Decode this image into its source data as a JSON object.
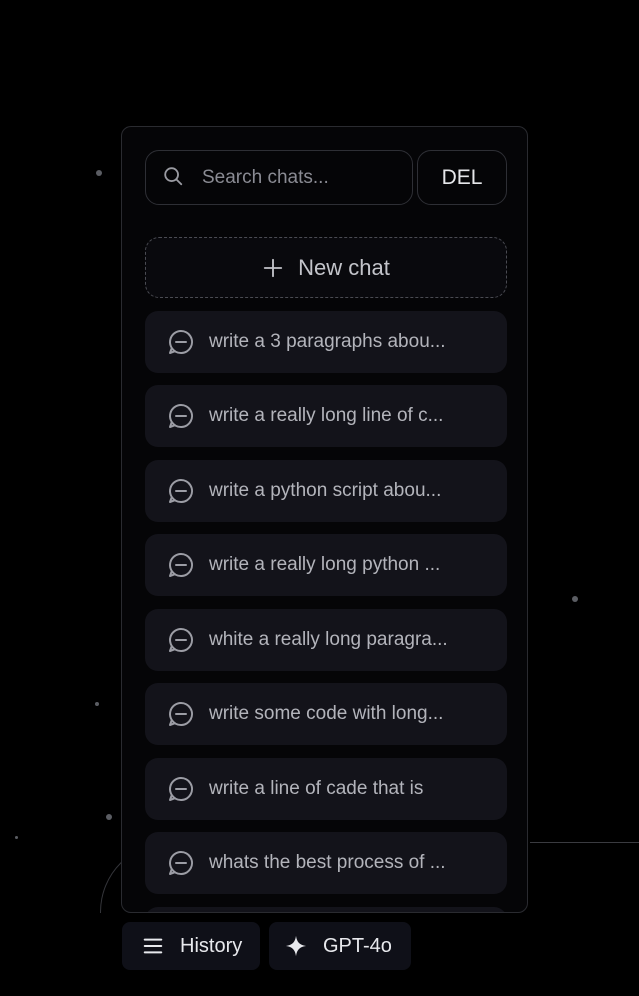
{
  "search": {
    "placeholder": "Search chats...",
    "value": "",
    "icon": "search-icon"
  },
  "delete_button": {
    "label": "DEL"
  },
  "new_chat": {
    "label": "New chat",
    "icon": "plus-icon"
  },
  "chats": [
    {
      "label": "write a 3 paragraphs abou...",
      "icon": "chat-bubble-icon"
    },
    {
      "label": "write a really long line of c...",
      "icon": "chat-bubble-icon"
    },
    {
      "label": "write a python script abou...",
      "icon": "chat-bubble-icon"
    },
    {
      "label": "write a really long python ...",
      "icon": "chat-bubble-icon"
    },
    {
      "label": "white a really long paragra...",
      "icon": "chat-bubble-icon"
    },
    {
      "label": "write some code with long...",
      "icon": "chat-bubble-icon"
    },
    {
      "label": "write a line of cade that is",
      "icon": "chat-bubble-icon"
    },
    {
      "label": "whats the best process of ...",
      "icon": "chat-bubble-icon"
    },
    {
      "label": "",
      "icon": "chat-bubble-icon"
    }
  ],
  "footer": {
    "history_label": "History",
    "history_icon": "menu-icon",
    "model_label": "GPT-4o",
    "model_icon": "sparkle-icon"
  },
  "colors": {
    "background": "#000000",
    "panel": "#050507",
    "chat_item": "#13131a",
    "text_muted": "#b3b4bb",
    "button_bg": "#0f1018"
  }
}
